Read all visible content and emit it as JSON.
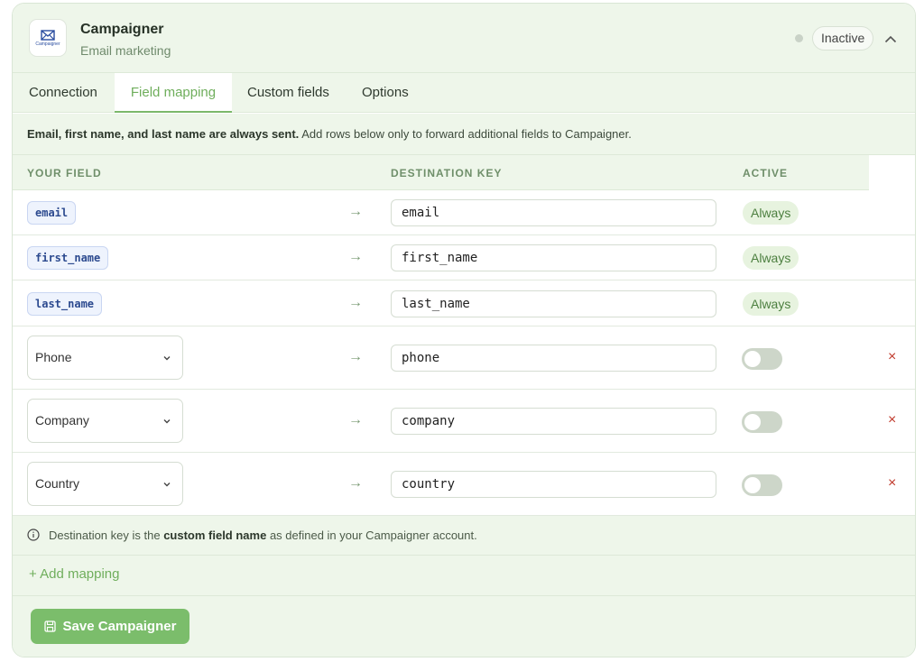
{
  "header": {
    "logo_text": "Campaigner",
    "title": "Campaigner",
    "subtitle": "Email marketing",
    "status": "Inactive"
  },
  "tabs": [
    {
      "label": "Connection"
    },
    {
      "label": "Field mapping"
    },
    {
      "label": "Custom fields"
    },
    {
      "label": "Options"
    }
  ],
  "info": {
    "bold": "Email, first name, and last name are always sent.",
    "rest": " Add rows below only to forward additional fields to Campaigner."
  },
  "columns": {
    "your_field": "YOUR FIELD",
    "destination_key": "DESTINATION KEY",
    "active": "ACTIVE"
  },
  "fixed_rows": [
    {
      "field": "email",
      "key": "email",
      "active": "Always"
    },
    {
      "field": "first_name",
      "key": "first_name",
      "active": "Always"
    },
    {
      "field": "last_name",
      "key": "last_name",
      "active": "Always"
    }
  ],
  "custom_rows": [
    {
      "field": "Phone",
      "key": "phone"
    },
    {
      "field": "Company",
      "key": "company"
    },
    {
      "field": "Country",
      "key": "country"
    }
  ],
  "arrow": "→",
  "remove": "×",
  "note": {
    "pre": "Destination key is the ",
    "bold": "custom field name",
    "post": " as defined in your Campaigner account."
  },
  "add_mapping": "+  Add mapping",
  "save_label": "Save Campaigner",
  "colors": {
    "accent": "#7bbd6b",
    "panel": "#eef6ea",
    "chip_bg": "#eef3fd",
    "chip_text": "#2c4a8f",
    "remove": "#c0392b"
  }
}
